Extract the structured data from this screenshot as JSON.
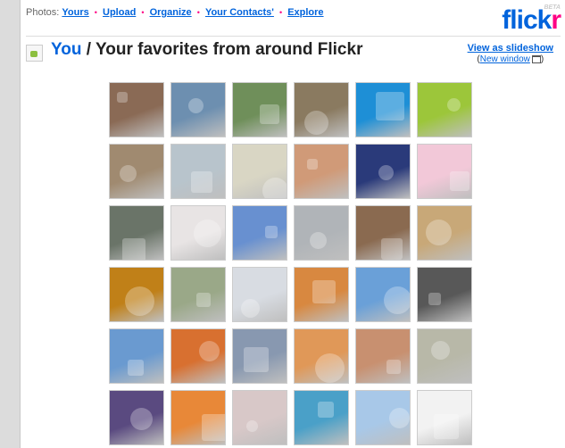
{
  "nav": {
    "prefix": "Photos:",
    "links": [
      "Yours",
      "Upload",
      "Organize",
      "Your Contacts'",
      "Explore"
    ],
    "separator": "•"
  },
  "logo": {
    "flick": "flick",
    "r": "r",
    "beta": "BETA"
  },
  "header": {
    "you": "You",
    "rest": " / Your favorites from around Flickr",
    "slideshow": "View as slideshow",
    "new_window_open": "(",
    "new_window": "New window",
    "new_window_close": ")"
  },
  "colors": {
    "link": "#0063dc",
    "accent": "#ff0084"
  },
  "thumbs": [
    [
      "#8a6a55",
      "#6d8fb0",
      "#6f8f5a",
      "#8a7a60",
      "#1e8fd6",
      "#9cc63a"
    ],
    [
      "#a08a70",
      "#b8c4cc",
      "#d9d6c4",
      "#d09a78",
      "#2a3a7a",
      "#f2c8d8"
    ],
    [
      "#6a7468",
      "#e8e4e4",
      "#6890d0",
      "#b0b4b8",
      "#8a6a50",
      "#c8a878"
    ],
    [
      "#c08018",
      "#9aa888",
      "#d8dce2",
      "#d88840",
      "#6aa0d8",
      "#585858"
    ],
    [
      "#6a9ad0",
      "#d87030",
      "#8898b0",
      "#e09858",
      "#c89070",
      "#b8b8a8"
    ],
    [
      "#5a4a80",
      "#e88838",
      "#d8c8c8",
      "#4aa0c8",
      "#a8c8e8",
      "#f2f2f2"
    ]
  ]
}
